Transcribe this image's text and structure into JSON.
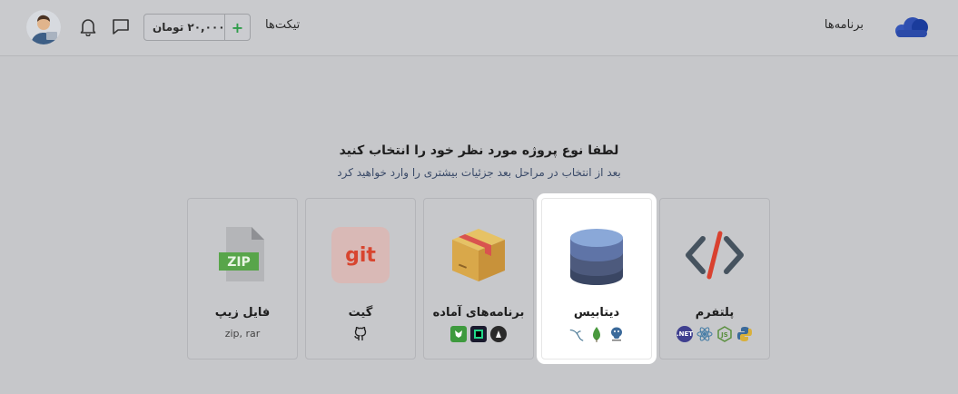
{
  "header": {
    "programs_label": "برنامه‌ها",
    "tickets_label": "تیکت‌ها",
    "wallet": {
      "amount": "۲۰,۰۰۰ تومان",
      "add_symbol": "+"
    }
  },
  "intro": {
    "title": "لطفا نوع پروژه مورد نظر خود را انتخاب کنید",
    "subtitle": "بعد از انتخاب در مراحل بعد جزئیات بیشتری را وارد خواهید کرد"
  },
  "cards": [
    {
      "label": "پلتفرم",
      "icons": [
        "python-icon",
        "nodejs-icon",
        "react-icon",
        "dotnet-icon"
      ],
      "selected": false
    },
    {
      "label": "دیتابیس",
      "icons": [
        "mysql-icon",
        "mongodb-icon",
        "postgresql-icon"
      ],
      "selected": true
    },
    {
      "label": "برنامه‌های آماده",
      "icons": [
        "nginx-icon",
        "pycharm-icon",
        "kibana-icon"
      ],
      "selected": false
    },
    {
      "label": "گیت",
      "icons": [
        "github-icon"
      ],
      "badge_text": "git",
      "selected": false
    },
    {
      "label": "فایل زیپ",
      "sub": "zip, rar",
      "badge_text": "ZIP",
      "selected": false
    }
  ],
  "icon_texts": {
    "dotnet": ".NET",
    "nodejs": "JS",
    "postgresql_sub": ""
  },
  "colors": {
    "accent": "#2f9d4a",
    "db_top": "#8aa8d8",
    "git": "#e05a45",
    "zip": "#58a54a",
    "code_red": "#d9412f"
  }
}
